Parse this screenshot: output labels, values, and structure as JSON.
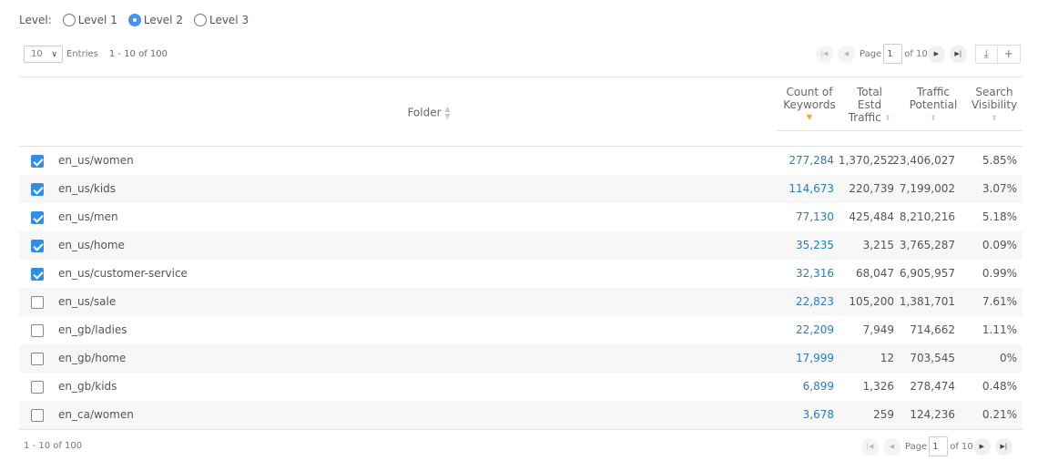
{
  "level": {
    "label": "Level:",
    "options": [
      {
        "label": "Level 1",
        "checked": false
      },
      {
        "label": "Level 2",
        "checked": true
      },
      {
        "label": "Level 3",
        "checked": false
      }
    ]
  },
  "entries": {
    "selected": "10",
    "label": "Entries",
    "range": "1 - 10 of 100"
  },
  "pager": {
    "page_label": "Page",
    "page_value": "1",
    "of_text": "of 10",
    "first_icon": "first-page-icon",
    "prev_icon": "prev-page-icon",
    "next_icon": "next-page-icon",
    "last_icon": "last-page-icon"
  },
  "toolbar": {
    "download_icon": "download-icon",
    "add_icon": "plus-icon"
  },
  "table": {
    "columns": {
      "folder": "Folder",
      "count_l1": "Count of",
      "count_l2": "Keywords",
      "traffic_l1": "Total",
      "traffic_l2": "Estd",
      "traffic_l3": "Traffic",
      "potential_l1": "Traffic",
      "potential_l2": "Potential",
      "visibility_l1": "Search",
      "visibility_l2": "Visibility"
    },
    "sorted_by": "Count of Keywords",
    "sort_direction": "descending",
    "rows": [
      {
        "checked": true,
        "folder": "en_us/women",
        "count": "277,284",
        "traffic": "1,370,252",
        "potential": "23,406,027",
        "visibility": "5.85%"
      },
      {
        "checked": true,
        "folder": "en_us/kids",
        "count": "114,673",
        "traffic": "220,739",
        "potential": "7,199,002",
        "visibility": "3.07%"
      },
      {
        "checked": true,
        "folder": "en_us/men",
        "count": "77,130",
        "traffic": "425,484",
        "potential": "8,210,216",
        "visibility": "5.18%"
      },
      {
        "checked": true,
        "folder": "en_us/home",
        "count": "35,235",
        "traffic": "3,215",
        "potential": "3,765,287",
        "visibility": "0.09%"
      },
      {
        "checked": true,
        "folder": "en_us/customer-service",
        "count": "32,316",
        "traffic": "68,047",
        "potential": "6,905,957",
        "visibility": "0.99%"
      },
      {
        "checked": false,
        "folder": "en_us/sale",
        "count": "22,823",
        "traffic": "105,200",
        "potential": "1,381,701",
        "visibility": "7.61%"
      },
      {
        "checked": false,
        "folder": "en_gb/ladies",
        "count": "22,209",
        "traffic": "7,949",
        "potential": "714,662",
        "visibility": "1.11%"
      },
      {
        "checked": false,
        "folder": "en_gb/home",
        "count": "17,999",
        "traffic": "12",
        "potential": "703,545",
        "visibility": "0%"
      },
      {
        "checked": false,
        "folder": "en_gb/kids",
        "count": "6,899",
        "traffic": "1,326",
        "potential": "278,474",
        "visibility": "0.48%"
      },
      {
        "checked": false,
        "folder": "en_ca/women",
        "count": "3,678",
        "traffic": "259",
        "potential": "124,236",
        "visibility": "0.21%"
      }
    ]
  },
  "footer": {
    "range": "1 - 10 of 100"
  },
  "colors": {
    "accent": "#2f8ee5",
    "link": "#2a7bbf",
    "sort_active": "#f5a623"
  }
}
